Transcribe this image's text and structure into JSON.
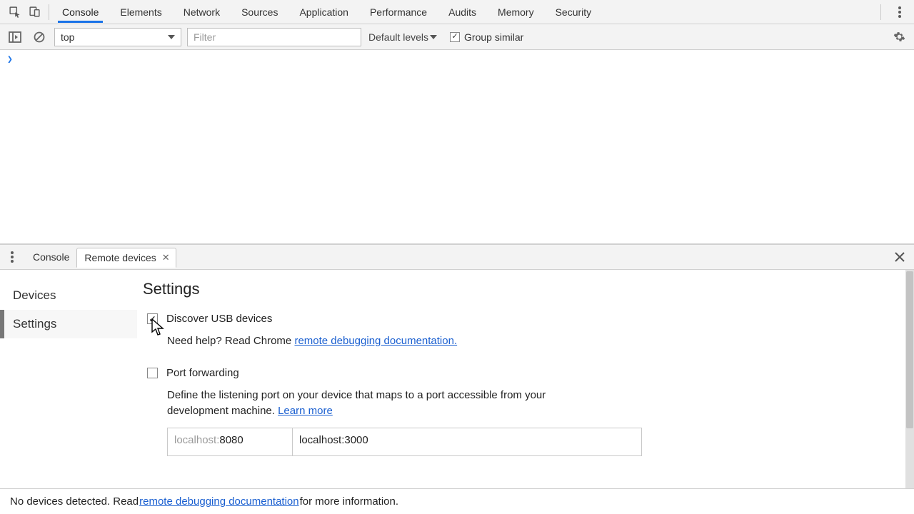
{
  "topTabs": {
    "items": [
      "Console",
      "Elements",
      "Network",
      "Sources",
      "Application",
      "Performance",
      "Audits",
      "Memory",
      "Security"
    ],
    "active": 0
  },
  "consoleToolbar": {
    "context": "top",
    "filterPlaceholder": "Filter",
    "levels": "Default levels",
    "groupSimilar": "Group similar",
    "groupSimilarChecked": true
  },
  "drawer": {
    "tabs": {
      "console": "Console",
      "remote": "Remote devices"
    },
    "sidebar": {
      "devices": "Devices",
      "settings": "Settings",
      "active": "settings"
    },
    "title": "Settings",
    "discover": {
      "label": "Discover USB devices",
      "checked": true,
      "helpPrefix": "Need help? Read Chrome ",
      "helpLink": "remote debugging documentation."
    },
    "portForwarding": {
      "label": "Port forwarding",
      "checked": false,
      "desc1": "Define the listening port on your device that maps to a port accessible from your development machine. ",
      "learnMore": "Learn more",
      "port": {
        "hint": "localhost:",
        "value": "8080"
      },
      "target": "localhost:3000"
    }
  },
  "footer": {
    "prefix": "No devices detected. Read ",
    "link": "remote debugging documentation",
    "suffix": " for more information."
  }
}
